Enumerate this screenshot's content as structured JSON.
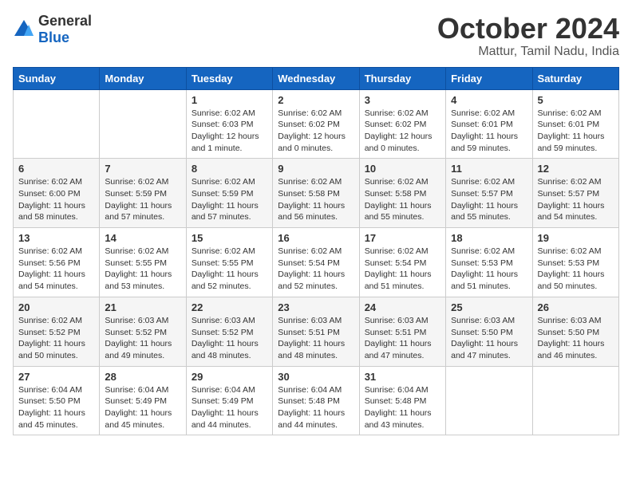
{
  "logo": {
    "general": "General",
    "blue": "Blue"
  },
  "title": "October 2024",
  "subtitle": "Mattur, Tamil Nadu, India",
  "days_of_week": [
    "Sunday",
    "Monday",
    "Tuesday",
    "Wednesday",
    "Thursday",
    "Friday",
    "Saturday"
  ],
  "weeks": [
    [
      {
        "day": "",
        "info": ""
      },
      {
        "day": "",
        "info": ""
      },
      {
        "day": "1",
        "info": "Sunrise: 6:02 AM\nSunset: 6:03 PM\nDaylight: 12 hours and 1 minute."
      },
      {
        "day": "2",
        "info": "Sunrise: 6:02 AM\nSunset: 6:02 PM\nDaylight: 12 hours and 0 minutes."
      },
      {
        "day": "3",
        "info": "Sunrise: 6:02 AM\nSunset: 6:02 PM\nDaylight: 12 hours and 0 minutes."
      },
      {
        "day": "4",
        "info": "Sunrise: 6:02 AM\nSunset: 6:01 PM\nDaylight: 11 hours and 59 minutes."
      },
      {
        "day": "5",
        "info": "Sunrise: 6:02 AM\nSunset: 6:01 PM\nDaylight: 11 hours and 59 minutes."
      }
    ],
    [
      {
        "day": "6",
        "info": "Sunrise: 6:02 AM\nSunset: 6:00 PM\nDaylight: 11 hours and 58 minutes."
      },
      {
        "day": "7",
        "info": "Sunrise: 6:02 AM\nSunset: 5:59 PM\nDaylight: 11 hours and 57 minutes."
      },
      {
        "day": "8",
        "info": "Sunrise: 6:02 AM\nSunset: 5:59 PM\nDaylight: 11 hours and 57 minutes."
      },
      {
        "day": "9",
        "info": "Sunrise: 6:02 AM\nSunset: 5:58 PM\nDaylight: 11 hours and 56 minutes."
      },
      {
        "day": "10",
        "info": "Sunrise: 6:02 AM\nSunset: 5:58 PM\nDaylight: 11 hours and 55 minutes."
      },
      {
        "day": "11",
        "info": "Sunrise: 6:02 AM\nSunset: 5:57 PM\nDaylight: 11 hours and 55 minutes."
      },
      {
        "day": "12",
        "info": "Sunrise: 6:02 AM\nSunset: 5:57 PM\nDaylight: 11 hours and 54 minutes."
      }
    ],
    [
      {
        "day": "13",
        "info": "Sunrise: 6:02 AM\nSunset: 5:56 PM\nDaylight: 11 hours and 54 minutes."
      },
      {
        "day": "14",
        "info": "Sunrise: 6:02 AM\nSunset: 5:55 PM\nDaylight: 11 hours and 53 minutes."
      },
      {
        "day": "15",
        "info": "Sunrise: 6:02 AM\nSunset: 5:55 PM\nDaylight: 11 hours and 52 minutes."
      },
      {
        "day": "16",
        "info": "Sunrise: 6:02 AM\nSunset: 5:54 PM\nDaylight: 11 hours and 52 minutes."
      },
      {
        "day": "17",
        "info": "Sunrise: 6:02 AM\nSunset: 5:54 PM\nDaylight: 11 hours and 51 minutes."
      },
      {
        "day": "18",
        "info": "Sunrise: 6:02 AM\nSunset: 5:53 PM\nDaylight: 11 hours and 51 minutes."
      },
      {
        "day": "19",
        "info": "Sunrise: 6:02 AM\nSunset: 5:53 PM\nDaylight: 11 hours and 50 minutes."
      }
    ],
    [
      {
        "day": "20",
        "info": "Sunrise: 6:02 AM\nSunset: 5:52 PM\nDaylight: 11 hours and 50 minutes."
      },
      {
        "day": "21",
        "info": "Sunrise: 6:03 AM\nSunset: 5:52 PM\nDaylight: 11 hours and 49 minutes."
      },
      {
        "day": "22",
        "info": "Sunrise: 6:03 AM\nSunset: 5:52 PM\nDaylight: 11 hours and 48 minutes."
      },
      {
        "day": "23",
        "info": "Sunrise: 6:03 AM\nSunset: 5:51 PM\nDaylight: 11 hours and 48 minutes."
      },
      {
        "day": "24",
        "info": "Sunrise: 6:03 AM\nSunset: 5:51 PM\nDaylight: 11 hours and 47 minutes."
      },
      {
        "day": "25",
        "info": "Sunrise: 6:03 AM\nSunset: 5:50 PM\nDaylight: 11 hours and 47 minutes."
      },
      {
        "day": "26",
        "info": "Sunrise: 6:03 AM\nSunset: 5:50 PM\nDaylight: 11 hours and 46 minutes."
      }
    ],
    [
      {
        "day": "27",
        "info": "Sunrise: 6:04 AM\nSunset: 5:50 PM\nDaylight: 11 hours and 45 minutes."
      },
      {
        "day": "28",
        "info": "Sunrise: 6:04 AM\nSunset: 5:49 PM\nDaylight: 11 hours and 45 minutes."
      },
      {
        "day": "29",
        "info": "Sunrise: 6:04 AM\nSunset: 5:49 PM\nDaylight: 11 hours and 44 minutes."
      },
      {
        "day": "30",
        "info": "Sunrise: 6:04 AM\nSunset: 5:48 PM\nDaylight: 11 hours and 44 minutes."
      },
      {
        "day": "31",
        "info": "Sunrise: 6:04 AM\nSunset: 5:48 PM\nDaylight: 11 hours and 43 minutes."
      },
      {
        "day": "",
        "info": ""
      },
      {
        "day": "",
        "info": ""
      }
    ]
  ]
}
